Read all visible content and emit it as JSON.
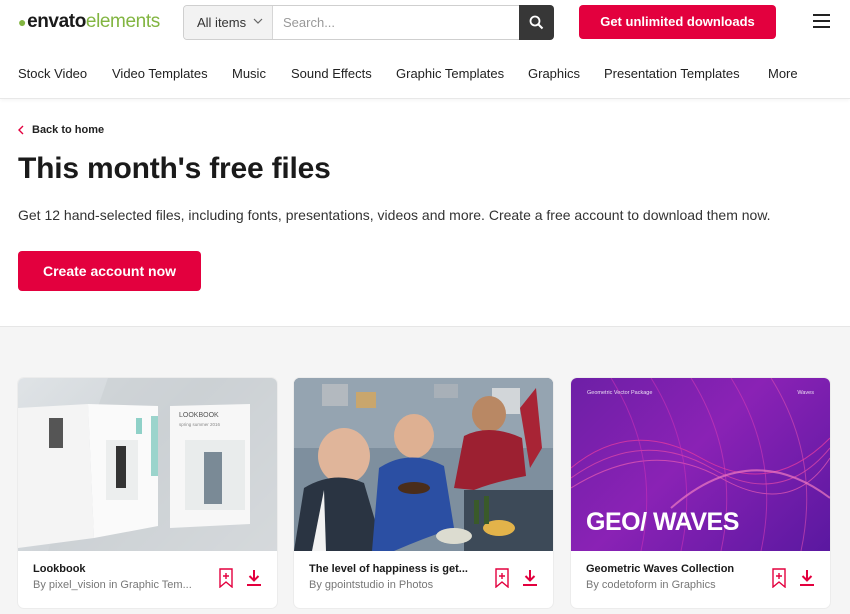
{
  "header": {
    "logo_word1": "envato",
    "logo_word2": "elements",
    "search": {
      "filter_label": "All items",
      "placeholder": "Search..."
    },
    "cta_label": "Get unlimited downloads"
  },
  "nav": {
    "items": [
      {
        "label": "Stock Video"
      },
      {
        "label": "Video Templates"
      },
      {
        "label": "Music"
      },
      {
        "label": "Sound Effects"
      },
      {
        "label": "Graphic Templates"
      },
      {
        "label": "Graphics"
      },
      {
        "label": "Presentation Templates"
      },
      {
        "label": "More"
      }
    ]
  },
  "hero": {
    "back_label": "Back to home",
    "title": "This month's free files",
    "subtitle": "Get 12 hand-selected files, including fonts, presentations, videos and more. Create a free account to download them now.",
    "cta_label": "Create account now"
  },
  "cards": [
    {
      "title": "Lookbook",
      "byline": "By pixel_vision in Graphic Tem...",
      "thumb_text": {
        "cover_title": "LOOKBOOK",
        "cover_sub": "spring summer 2016"
      }
    },
    {
      "title": "The level of happiness is get...",
      "byline": "By gpointstudio in Photos"
    },
    {
      "title": "Geometric Waves Collection",
      "byline": "By codetoform in Graphics",
      "thumb_text": {
        "big": "GEO/ WAVES",
        "top_left": "Geometric Vector Package",
        "top_right": "Waves"
      }
    }
  ],
  "colors": {
    "brand_red": "#e3003e",
    "brand_green": "#82b541",
    "dark": "#373737"
  },
  "icons": [
    "search-icon",
    "chevron-down-icon",
    "menu-icon",
    "chevron-left-icon",
    "bookmark-icon",
    "download-icon"
  ]
}
